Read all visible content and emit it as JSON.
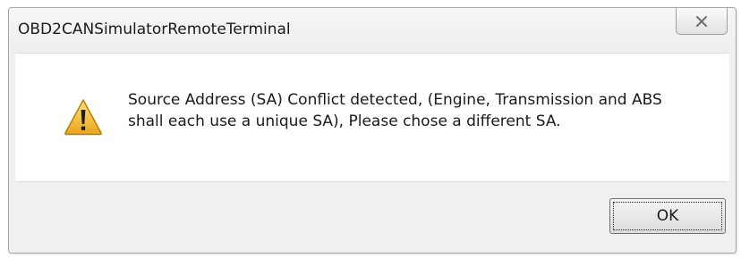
{
  "window": {
    "title": "OBD2CANSimulatorRemoteTerminal",
    "close_icon": "close-icon"
  },
  "message": {
    "icon": "warning-icon",
    "line1": "Source Address (SA) Conflict detected, (Engine, Transmission and ABS",
    "line2": "shall each use a unique SA), Please chose a different SA."
  },
  "buttons": {
    "ok_label": "OK"
  },
  "colors": {
    "warning_fill": "#f5c33b",
    "warning_stroke": "#b57e08",
    "dialog_bg": "#f0f0f0",
    "content_bg": "#ffffff"
  }
}
